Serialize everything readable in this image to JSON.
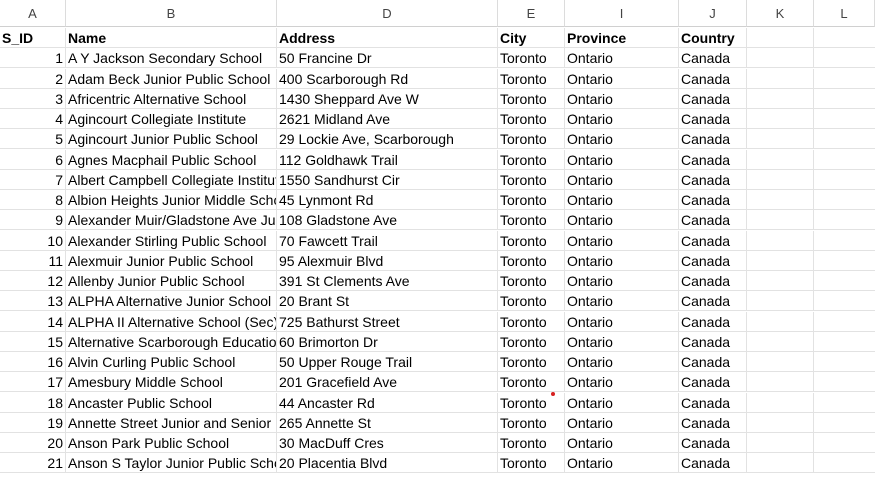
{
  "columns": [
    "A",
    "B",
    "D",
    "E",
    "I",
    "J",
    "K",
    "L"
  ],
  "header": {
    "sid": "S_ID",
    "name": "Name",
    "address": "Address",
    "city": "City",
    "province": "Province",
    "country": "Country"
  },
  "rows": [
    {
      "id": "1",
      "name": "A Y Jackson Secondary School",
      "address": "50 Francine Dr",
      "city": "Toronto",
      "province": "Ontario",
      "country": "Canada"
    },
    {
      "id": "2",
      "name": "Adam Beck Junior Public School",
      "address": "400 Scarborough Rd",
      "city": "Toronto",
      "province": "Ontario",
      "country": "Canada"
    },
    {
      "id": "3",
      "name": "Africentric Alternative School",
      "address": "1430 Sheppard Ave W",
      "city": "Toronto",
      "province": "Ontario",
      "country": "Canada"
    },
    {
      "id": "4",
      "name": "Agincourt Collegiate Institute",
      "address": "2621 Midland Ave",
      "city": "Toronto",
      "province": "Ontario",
      "country": "Canada"
    },
    {
      "id": "5",
      "name": "Agincourt Junior Public School",
      "address": "29 Lockie Ave, Scarborough",
      "city": "Toronto",
      "province": "Ontario",
      "country": "Canada"
    },
    {
      "id": "6",
      "name": "Agnes Macphail Public School",
      "address": "112 Goldhawk Trail",
      "city": "Toronto",
      "province": "Ontario",
      "country": "Canada"
    },
    {
      "id": "7",
      "name": "Albert Campbell Collegiate Institute",
      "address": "1550 Sandhurst Cir",
      "city": "Toronto",
      "province": "Ontario",
      "country": "Canada"
    },
    {
      "id": "8",
      "name": "Albion Heights Junior Middle School",
      "address": "45 Lynmont Rd",
      "city": "Toronto",
      "province": "Ontario",
      "country": "Canada"
    },
    {
      "id": "9",
      "name": "Alexander Muir/Gladstone Ave Junior",
      "address": "108 Gladstone Ave",
      "city": "Toronto",
      "province": "Ontario",
      "country": "Canada"
    },
    {
      "id": "10",
      "name": "Alexander Stirling Public School",
      "address": "70 Fawcett Trail",
      "city": "Toronto",
      "province": "Ontario",
      "country": "Canada"
    },
    {
      "id": "11",
      "name": "Alexmuir Junior Public School",
      "address": "95 Alexmuir Blvd",
      "city": "Toronto",
      "province": "Ontario",
      "country": "Canada"
    },
    {
      "id": "12",
      "name": "Allenby Junior Public School",
      "address": "391 St Clements Ave",
      "city": "Toronto",
      "province": "Ontario",
      "country": "Canada"
    },
    {
      "id": "13",
      "name": "ALPHA Alternative Junior School",
      "address": "20 Brant St",
      "city": "Toronto",
      "province": "Ontario",
      "country": "Canada"
    },
    {
      "id": "14",
      "name": "ALPHA II Alternative School (Sec)",
      "address": "725 Bathurst Street",
      "city": "Toronto",
      "province": "Ontario",
      "country": "Canada"
    },
    {
      "id": "15",
      "name": "Alternative Scarborough Education",
      "address": "60 Brimorton Dr",
      "city": "Toronto",
      "province": "Ontario",
      "country": "Canada"
    },
    {
      "id": "16",
      "name": "Alvin Curling Public School",
      "address": "50 Upper Rouge Trail",
      "city": "Toronto",
      "province": "Ontario",
      "country": "Canada"
    },
    {
      "id": "17",
      "name": "Amesbury Middle School",
      "address": "201 Gracefield Ave",
      "city": "Toronto",
      "province": "Ontario",
      "country": "Canada"
    },
    {
      "id": "18",
      "name": "Ancaster Public School",
      "address": "44 Ancaster Rd",
      "city": "Toronto",
      "province": "Ontario",
      "country": "Canada"
    },
    {
      "id": "19",
      "name": "Annette Street Junior and Senior Public",
      "address": "265 Annette St",
      "city": "Toronto",
      "province": "Ontario",
      "country": "Canada"
    },
    {
      "id": "20",
      "name": "Anson Park Public School",
      "address": "30 MacDuff Cres",
      "city": "Toronto",
      "province": "Ontario",
      "country": "Canada"
    },
    {
      "id": "21",
      "name": "Anson S Taylor Junior Public School",
      "address": "20 Placentia Blvd",
      "city": "Toronto",
      "province": "Ontario",
      "country": "Canada"
    }
  ],
  "comment_marker_row": 17,
  "colors": {
    "grid_line": "#e2e2e2",
    "header_text": "#444444",
    "comment_marker": "#d62020"
  }
}
